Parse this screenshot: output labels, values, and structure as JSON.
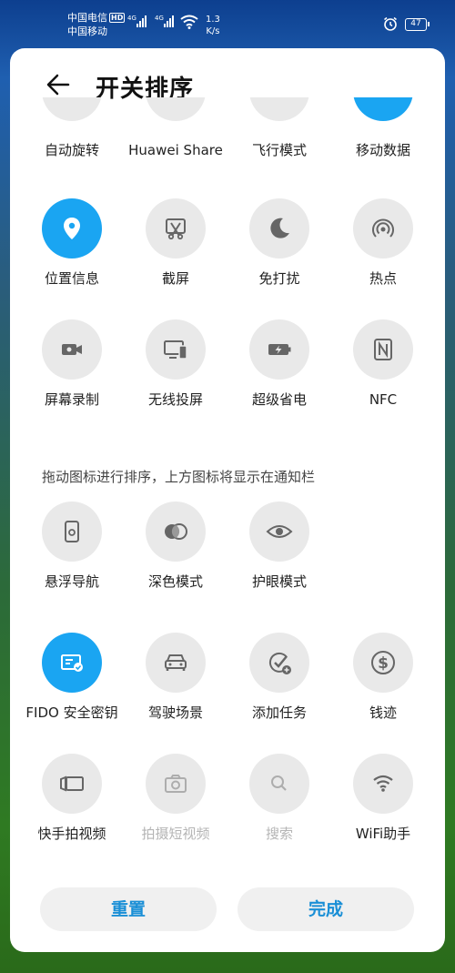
{
  "status_bar": {
    "carrier1": "中国电信",
    "hd": "HD",
    "carrier2": "中国移动",
    "net1": "4G",
    "net2": "4G",
    "speed_value": "1.3",
    "speed_unit": "K/s",
    "battery": "47"
  },
  "header": {
    "title": "开关排序"
  },
  "top_section": {
    "row1": [
      "自动旋转",
      "Huawei Share",
      "飞行模式",
      "移动数据"
    ],
    "row2": [
      "位置信息",
      "截屏",
      "免打扰",
      "热点"
    ],
    "row3": [
      "屏幕录制",
      "无线投屏",
      "超级省电",
      "NFC"
    ]
  },
  "hint": "拖动图标进行排序，上方图标将显示在通知栏",
  "bottom_section": {
    "row1": [
      "悬浮导航",
      "深色模式",
      "护眼模式"
    ],
    "row2": [
      "FIDO 安全密钥",
      "驾驶场景",
      "添加任务",
      "钱迹"
    ],
    "row3": [
      "快手拍视频",
      "拍摄短视频",
      "搜索",
      "WiFi助手"
    ]
  },
  "buttons": {
    "reset": "重置",
    "done": "完成"
  },
  "colors": {
    "accent": "#1aa5f2",
    "button_text": "#1a8fd6",
    "tile_bg": "#e9e9e9"
  }
}
